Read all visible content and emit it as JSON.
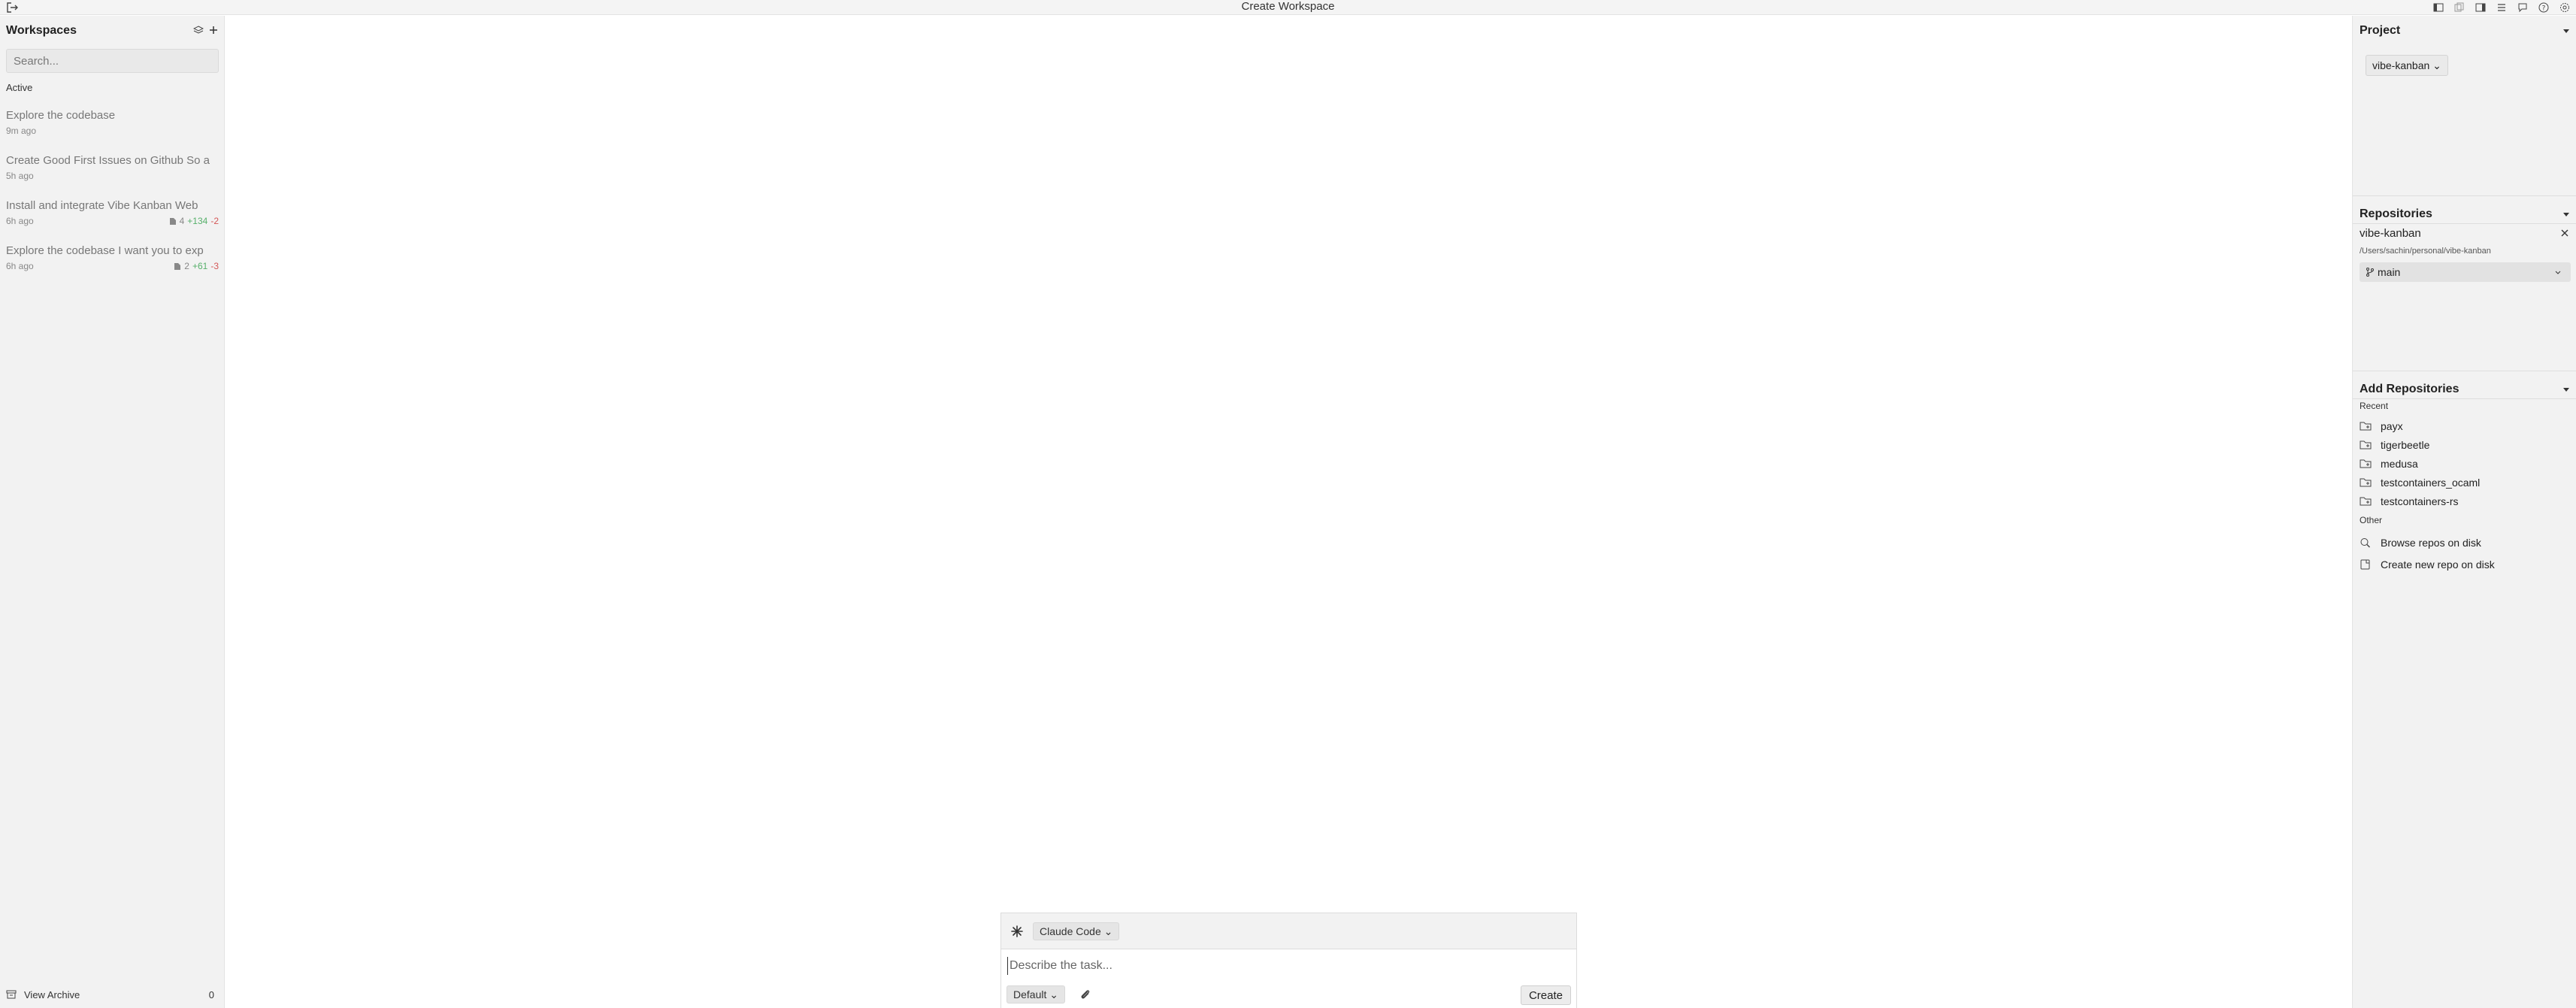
{
  "window": {
    "title": "Create Workspace"
  },
  "toolbar": {
    "icons": [
      "panel-left-icon",
      "copy-icon",
      "panel-right-icon",
      "list-icon",
      "chat-icon",
      "help-icon",
      "settings-icon"
    ]
  },
  "workspaces": {
    "title": "Workspaces",
    "search_placeholder": "Search...",
    "active_label": "Active",
    "items": [
      {
        "name": "Explore the codebase",
        "time": "9m ago"
      },
      {
        "name": "Create Good First Issues on Github So a",
        "time": "5h ago"
      },
      {
        "name": "Install and integrate Vibe Kanban Web",
        "time": "6h ago",
        "files": "4",
        "added": "+134",
        "removed": "-2"
      },
      {
        "name": "Explore the codebase I want you to exp",
        "time": "6h ago",
        "files": "2",
        "added": "+61",
        "removed": "-3"
      }
    ],
    "archive_label": "View Archive",
    "archive_count": "0"
  },
  "composer": {
    "agent": "Claude Code",
    "placeholder": "Describe the task...",
    "variant": "Default",
    "create_label": "Create"
  },
  "project": {
    "title": "Project",
    "selected": "vibe-kanban"
  },
  "repositories": {
    "title": "Repositories",
    "name": "vibe-kanban",
    "path": "/Users/sachin/personal/vibe-kanban",
    "branch": "main"
  },
  "add_repositories": {
    "title": "Add Repositories",
    "recent_label": "Recent",
    "recent": [
      "payx",
      "tigerbeetle",
      "medusa",
      "testcontainers_ocaml",
      "testcontainers-rs"
    ],
    "other_label": "Other",
    "browse_label": "Browse repos on disk",
    "create_label": "Create new repo on disk"
  }
}
